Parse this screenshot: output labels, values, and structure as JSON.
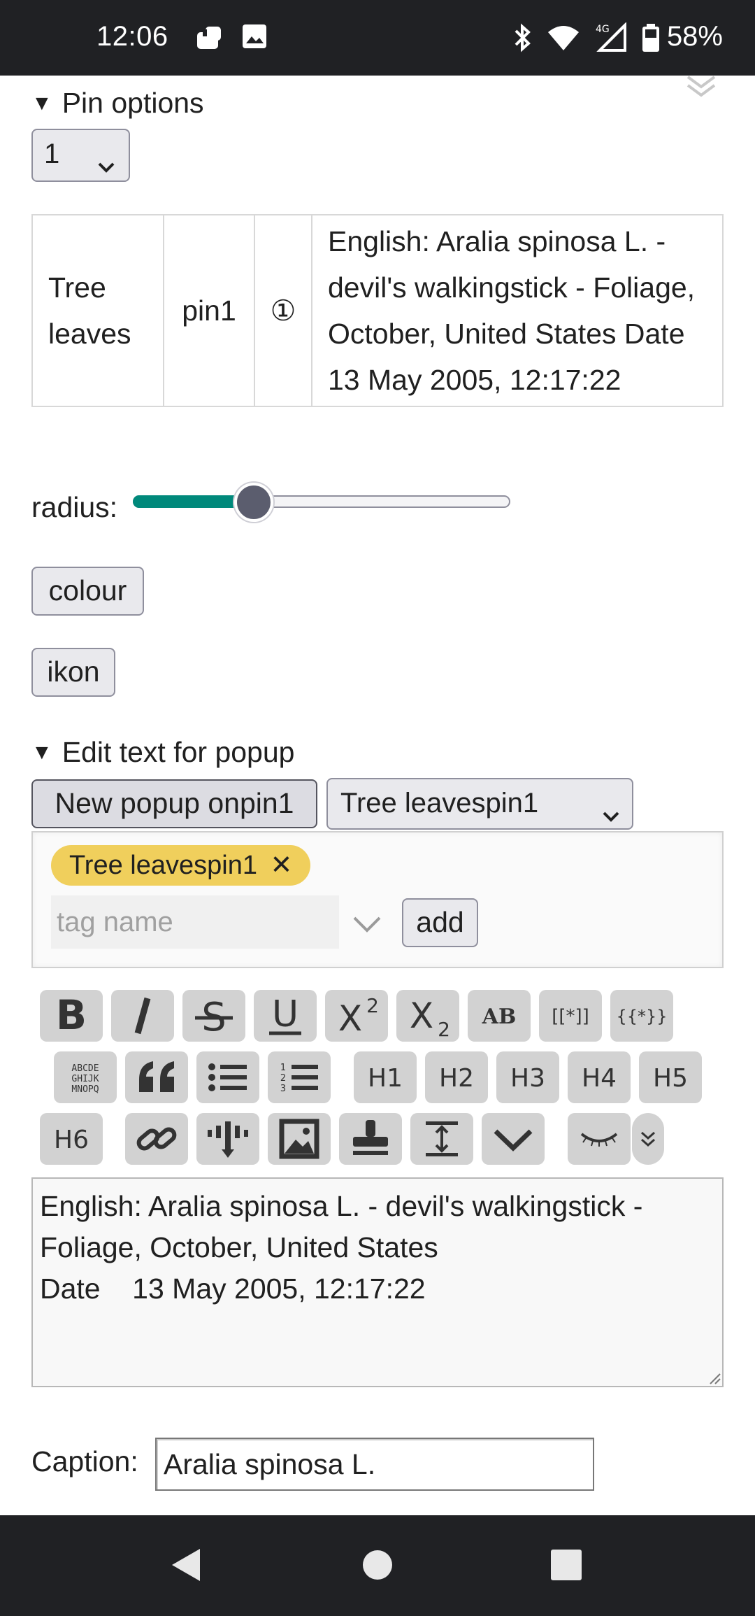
{
  "status_bar": {
    "time": "12:06",
    "battery": "58%"
  },
  "pin_options": {
    "summary": "Pin options",
    "selected": "1",
    "row": {
      "name": "Tree leaves",
      "pin": "pin1",
      "marker": "①",
      "description": "English: Aralia spinosa L. - devil's walkingstick - Foliage, October, United States Date 13 May 2005, 12:17:22"
    },
    "radius_label": "radius:",
    "radius_value": 0.32,
    "colour_button": "colour",
    "ikon_button": "ikon"
  },
  "popup": {
    "summary": "Edit text for popup",
    "new_popup_button": "New popup onpin1",
    "popup_select": "Tree leavespin1",
    "chip_label": "Tree leavespin1",
    "chip_close": "✕",
    "tag_placeholder": "tag name",
    "add_button": "add"
  },
  "toolbar": {
    "row1": [
      "B",
      "I",
      "S",
      "U",
      "X2",
      "X2",
      "AB",
      "[[*]]",
      "{{*}}"
    ],
    "row2": [
      "ABCDE GHIJK MNOPQ",
      "quote",
      "bullet-list",
      "numbered-list",
      "H1",
      "H2",
      "H3",
      "H4",
      "H5"
    ],
    "row3": [
      "H6",
      "link",
      "map-pin",
      "image",
      "stamp",
      "line-height",
      "chevron-down",
      "eye-closed",
      "expand"
    ]
  },
  "editor_text": "English: Aralia spinosa L. - devil's walkingstick -\nFoliage, October, United States\nDate    13 May 2005, 12:17:22",
  "caption": {
    "label": "Caption:",
    "value": "Aralia spinosa L."
  }
}
